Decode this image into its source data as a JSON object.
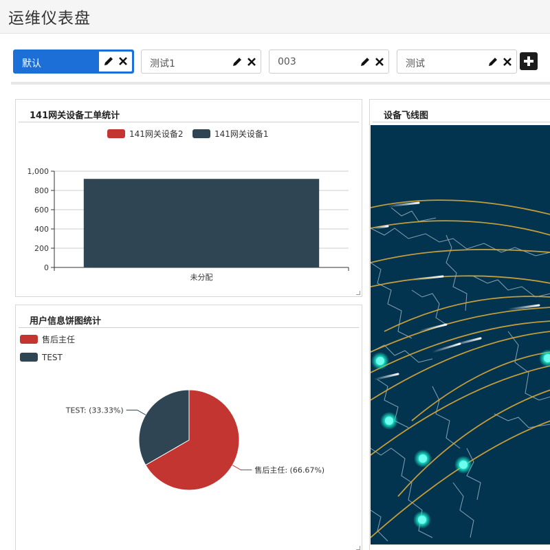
{
  "header": {
    "title": "运维仪表盘"
  },
  "tabs": [
    {
      "label": "默认",
      "active": true
    },
    {
      "label": "测试1",
      "active": false
    },
    {
      "label": "003",
      "active": false
    },
    {
      "label": "测试",
      "active": false
    }
  ],
  "panels": {
    "bar": {
      "title": "141网关设备工单统计"
    },
    "pie": {
      "title": "用户信息饼图统计"
    },
    "map": {
      "title": "设备飞线图"
    }
  },
  "colors": {
    "accent": "#1b6fd6",
    "red": "#c23531",
    "dark": "#2f4554",
    "map_bg": "#03344f",
    "flight_line": "#d8a93a",
    "node": "#19e6c8"
  },
  "chart_data": [
    {
      "type": "bar",
      "title": "141网关设备工单统计",
      "categories": [
        "未分配"
      ],
      "series": [
        {
          "name": "141网关设备2",
          "values": [
            0
          ],
          "color": "#c23531"
        },
        {
          "name": "141网关设备1",
          "values": [
            920
          ],
          "color": "#2f4554"
        }
      ],
      "yticks": [
        "0",
        "200",
        "400",
        "600",
        "800",
        "1,000"
      ],
      "ylim": [
        0,
        1000
      ],
      "legend": "top-center",
      "grid": true
    },
    {
      "type": "pie",
      "title": "用户信息饼图统计",
      "slices": [
        {
          "name": "售后主任",
          "value": 66.67,
          "label": "售后主任: (66.67%)",
          "color": "#c23531"
        },
        {
          "name": "TEST",
          "value": 33.33,
          "label": "TEST: (33.33%)",
          "color": "#2f4554"
        }
      ],
      "legend": "top-left"
    }
  ]
}
